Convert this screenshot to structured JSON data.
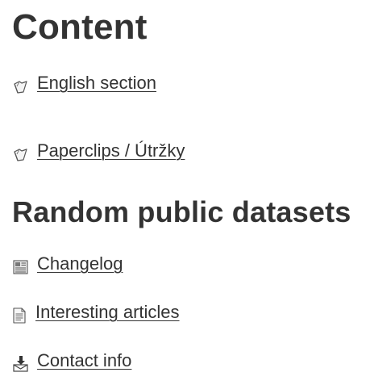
{
  "content": {
    "heading": "Content",
    "items": [
      {
        "label": "English section",
        "icon": "folder-icon"
      },
      {
        "label": "Paperclips / Útržky",
        "icon": "folder-icon"
      }
    ]
  },
  "datasets": {
    "heading": "Random public datasets",
    "items": [
      {
        "label": "Changelog",
        "icon": "newspaper-icon"
      },
      {
        "label": "Interesting articles",
        "icon": "document-icon"
      },
      {
        "label": "Contact info",
        "icon": "mail-inbox-icon"
      }
    ]
  }
}
